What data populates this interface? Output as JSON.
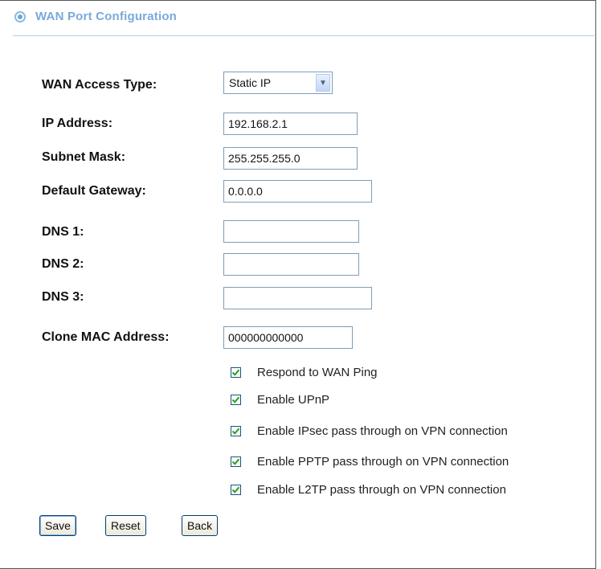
{
  "header": {
    "title": "WAN Port Configuration"
  },
  "form": {
    "wan_access_type": {
      "label": "WAN Access Type:",
      "value": "Static IP"
    },
    "ip_address": {
      "label": "IP Address:",
      "value": "192.168.2.1"
    },
    "subnet_mask": {
      "label": "Subnet Mask:",
      "value": "255.255.255.0"
    },
    "default_gateway": {
      "label": "Default Gateway:",
      "value": "0.0.0.0"
    },
    "dns1": {
      "label": "DNS 1:",
      "value": ""
    },
    "dns2": {
      "label": "DNS 2:",
      "value": ""
    },
    "dns3": {
      "label": "DNS 3:",
      "value": ""
    },
    "clone_mac": {
      "label": "Clone MAC Address:",
      "value": "000000000000"
    }
  },
  "options": [
    {
      "label": "Respond to WAN Ping",
      "checked": true
    },
    {
      "label": "Enable UPnP",
      "checked": true
    },
    {
      "label": "Enable IPsec pass through on VPN connection",
      "checked": true
    },
    {
      "label": "Enable PPTP pass through on VPN connection",
      "checked": true
    },
    {
      "label": "Enable L2TP pass through on VPN connection",
      "checked": true
    }
  ],
  "buttons": {
    "save": "Save",
    "reset": "Reset",
    "back": "Back"
  },
  "colors": {
    "header_text": "#7aa9dc",
    "checkmark": "#21a121",
    "input_border": "#7f9db9"
  }
}
